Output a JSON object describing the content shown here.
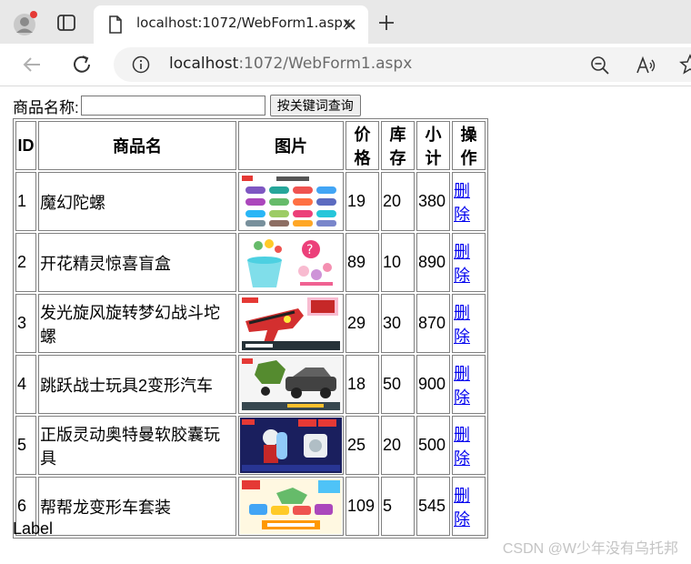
{
  "browser": {
    "tab_title": "localhost:1072/WebForm1.aspx",
    "url_host": "localhost",
    "url_rest": ":1072/WebForm1.aspx"
  },
  "search": {
    "label": "商品名称:",
    "value": "",
    "button": "按关键词查询"
  },
  "table": {
    "headers": [
      "ID",
      "商品名",
      "图片",
      "价格",
      "库存",
      "小计",
      "操作"
    ],
    "rows": [
      {
        "id": "1",
        "name": "魔幻陀螺",
        "image": "spinning-tops-product-image",
        "price": "19",
        "stock": "20",
        "subtotal": "380",
        "action": "删除"
      },
      {
        "id": "2",
        "name": "开花精灵惊喜盲盒",
        "image": "flower-pot-blind-box-product-image",
        "price": "89",
        "stock": "10",
        "subtotal": "890",
        "action": "删除"
      },
      {
        "id": "3",
        "name": "发光旋风旋转梦幻战斗坨螺",
        "image": "glowing-launcher-product-image",
        "price": "29",
        "stock": "30",
        "subtotal": "870",
        "action": "删除"
      },
      {
        "id": "4",
        "name": "跳跃战士玩具2变形汽车",
        "image": "transforming-car-product-image",
        "price": "18",
        "stock": "50",
        "subtotal": "900",
        "action": "删除"
      },
      {
        "id": "5",
        "name": "正版灵动奥特曼软胶囊玩具",
        "image": "ultraman-capsule-product-image",
        "price": "25",
        "stock": "20",
        "subtotal": "500",
        "action": "删除"
      },
      {
        "id": "6",
        "name": "帮帮龙变形车套装",
        "image": "dino-car-set-product-image",
        "price": "109",
        "stock": "5",
        "subtotal": "545",
        "action": "删除"
      }
    ]
  },
  "footer_label": "Label",
  "watermark": "CSDN @W少年没有乌托邦"
}
